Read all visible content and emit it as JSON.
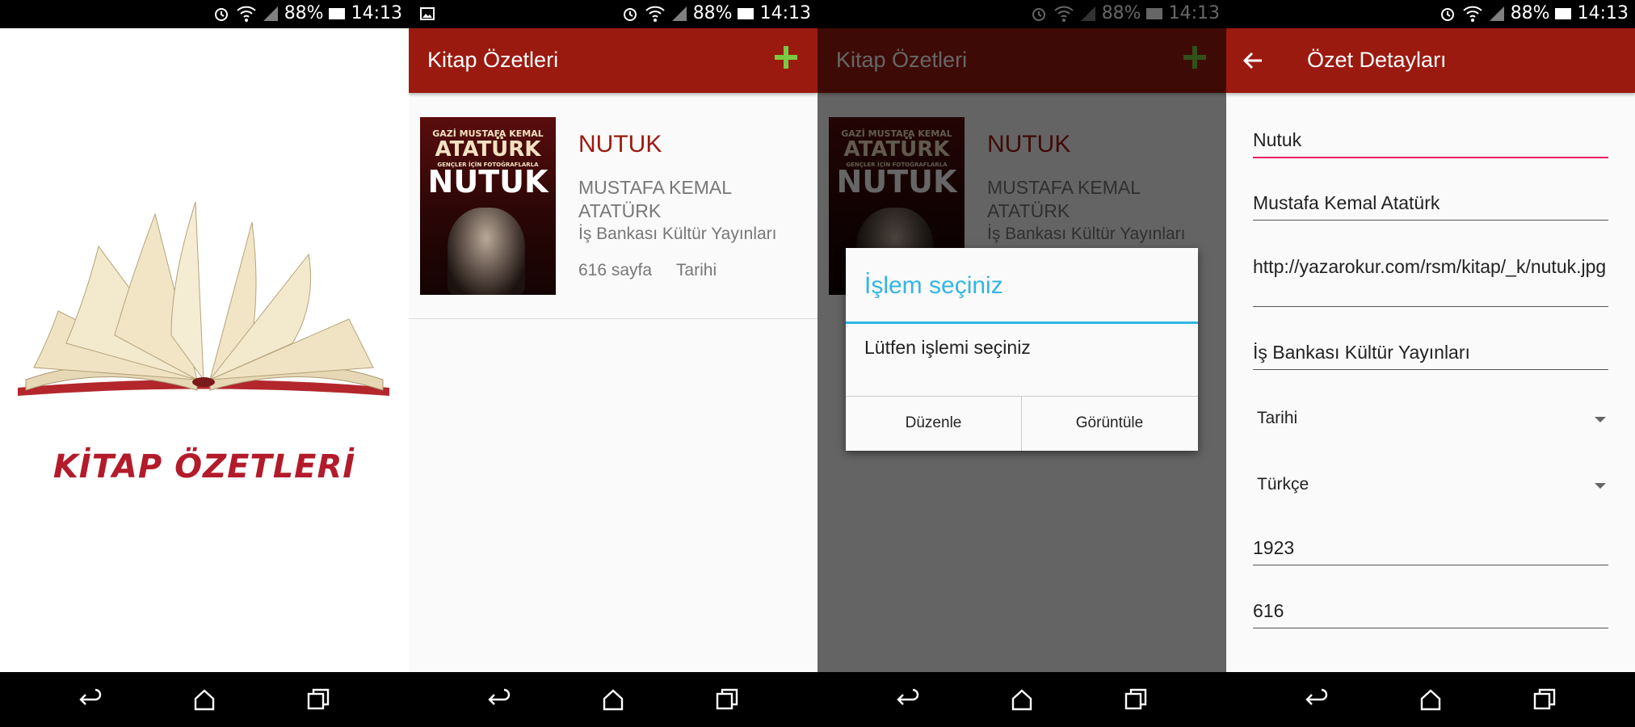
{
  "status_bar": {
    "battery": "88%",
    "time": "14:13"
  },
  "splash": {
    "app_name": "KİTAP ÖZETLERİ"
  },
  "list_screen": {
    "title": "Kitap Özetleri",
    "add_icon": "plus-icon",
    "book": {
      "cover_line1": "GAZİ MUSTAFA KEMAL",
      "cover_line2": "ATATÜRK",
      "cover_line3": "GENÇLER İÇİN FOTOĞRAFLARLA",
      "cover_line4": "NUTUK",
      "title": "NUTUK",
      "author": "MUSTAFA KEMAL ATATÜRK",
      "publisher": "İş Bankası Kültür Yayınları",
      "pages": "616 sayfa",
      "category": "Tarihi"
    }
  },
  "dialog": {
    "title": "İşlem seçiniz",
    "message": "Lütfen işlemi seçiniz",
    "edit_button": "Düzenle",
    "view_button": "Görüntüle"
  },
  "detail_screen": {
    "title": "Özet Detayları",
    "fields": {
      "name": "Nutuk",
      "author": "Mustafa Kemal Atatürk",
      "image_url": "http://yazarokur.com/rsm/kitap/_k/nutuk.jpg",
      "publisher": "İş Bankası Kültür Yayınları",
      "category": "Tarihi",
      "language": "Türkçe",
      "year": "1923",
      "pages": "616"
    }
  },
  "colors": {
    "app_bar": "#9b1a0f",
    "accent_green": "#7ac943",
    "dialog_accent": "#33b5e5",
    "focus_underline": "#e91e63"
  }
}
